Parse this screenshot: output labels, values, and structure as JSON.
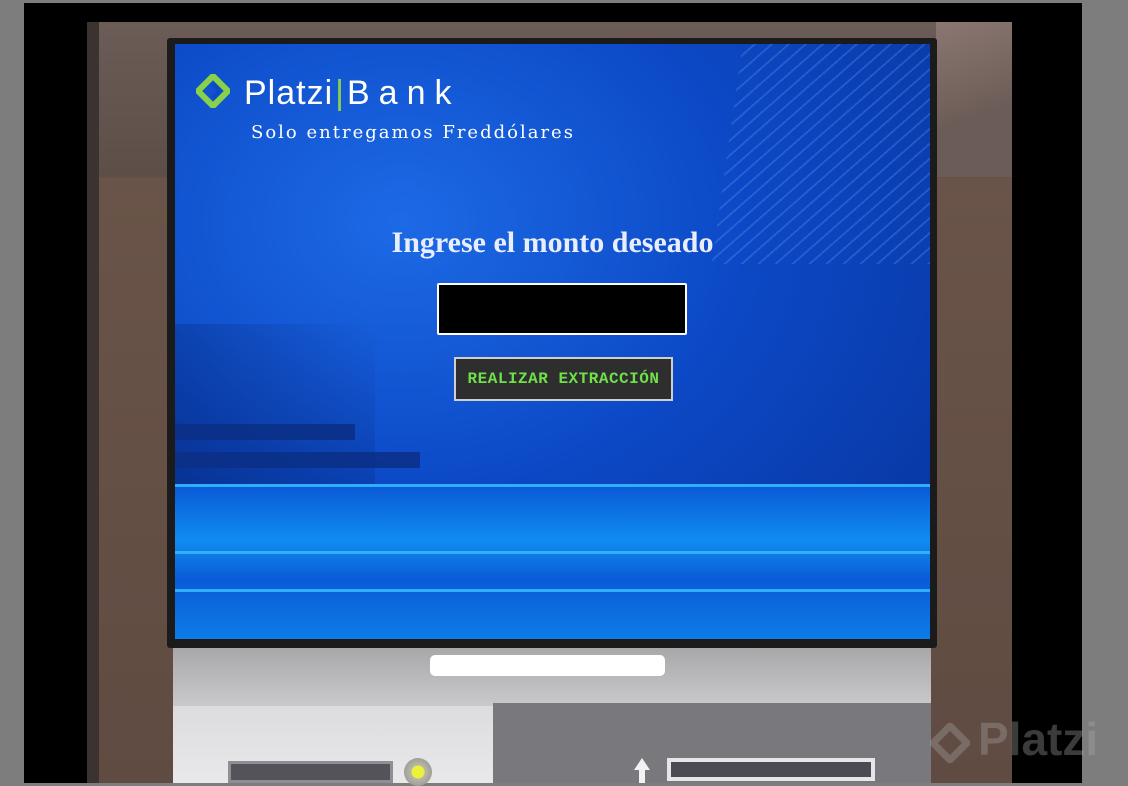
{
  "brand": {
    "name_left": "Platzi",
    "name_right": "Bank",
    "separator": "|",
    "tagline": "Solo entregamos Freddólares",
    "logo_icon": "platzi-diamond-icon",
    "accent_color": "#8ad14a"
  },
  "screen": {
    "prompt": "Ingrese el monto deseado",
    "amount_input": {
      "value": "",
      "placeholder": ""
    },
    "withdraw_button_label": "REALIZAR EXTRACCIÓN"
  },
  "watermark": {
    "text": "Platzi",
    "icon": "platzi-diamond-icon"
  },
  "colors": {
    "screen_blue": "#0c49c6",
    "button_text": "#6ee04a",
    "button_bg": "#2e2e2e"
  }
}
